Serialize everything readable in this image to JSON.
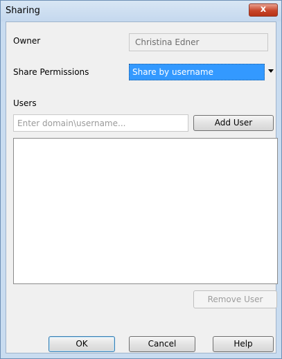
{
  "window": {
    "title": "Sharing",
    "close_glyph": "x"
  },
  "owner": {
    "label": "Owner",
    "value": "Christina Edner"
  },
  "permissions": {
    "label": "Share Permissions",
    "selected": "Share by username"
  },
  "users": {
    "label": "Users",
    "input_placeholder": "Enter domain\\username...",
    "add_button": "Add User",
    "list_items": [],
    "remove_button": "Remove User"
  },
  "footer": {
    "ok": "OK",
    "cancel": "Cancel",
    "help": "Help"
  },
  "colors": {
    "selection_blue": "#3399ff",
    "window_frame": "#c9dcf0",
    "close_red": "#c7452a"
  }
}
